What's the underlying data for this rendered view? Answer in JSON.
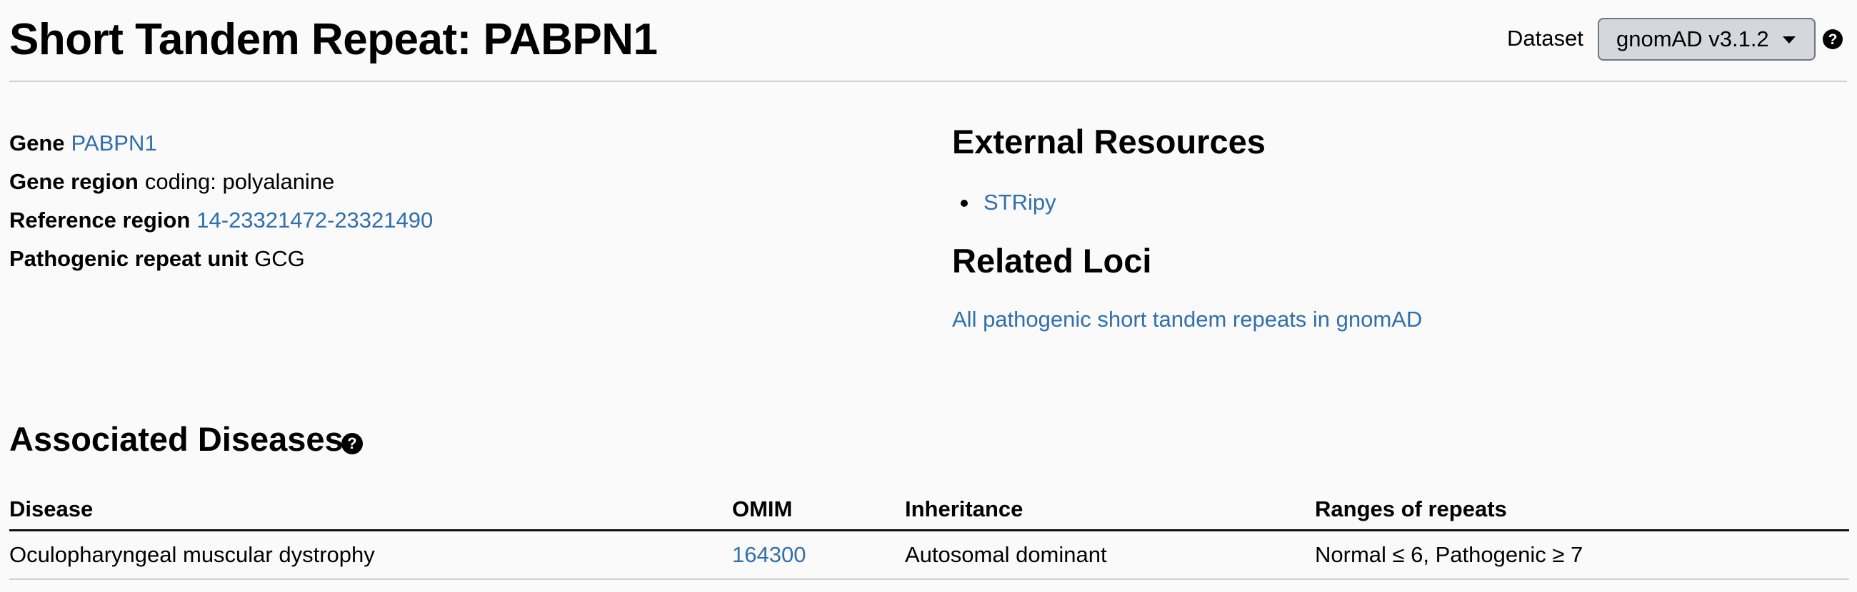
{
  "header": {
    "title": "Short Tandem Repeat: PABPN1",
    "dataset_label": "Dataset",
    "dataset_value": "gnomAD v3.1.2",
    "help_glyph": "?"
  },
  "attributes": {
    "gene_label": "Gene",
    "gene_value": "PABPN1",
    "gene_region_label": "Gene region",
    "gene_region_value": "coding: polyalanine",
    "reference_region_label": "Reference region",
    "reference_region_value": "14-23321472-23321490",
    "repeat_unit_label": "Pathogenic repeat unit",
    "repeat_unit_value": "GCG"
  },
  "external_resources": {
    "title": "External Resources",
    "items": [
      {
        "label": "STRipy"
      }
    ]
  },
  "related_loci": {
    "title": "Related Loci",
    "link": "All pathogenic short tandem repeats in gnomAD"
  },
  "diseases": {
    "title": "Associated Diseases",
    "help_glyph": "?",
    "columns": [
      "Disease",
      "OMIM",
      "Inheritance",
      "Ranges of repeats"
    ],
    "rows": [
      {
        "disease": "Oculopharyngeal muscular dystrophy",
        "omim": "164300",
        "inheritance": "Autosomal dominant",
        "ranges": "Normal ≤ 6, Pathogenic ≥ 7"
      }
    ]
  },
  "colors": {
    "link": "#2f6fad",
    "background": "#fafafa",
    "select_bg": "#d4d8dd"
  },
  "icons": {
    "dataset_dropdown": "chevron-down-icon",
    "help": "question-circle-icon"
  }
}
